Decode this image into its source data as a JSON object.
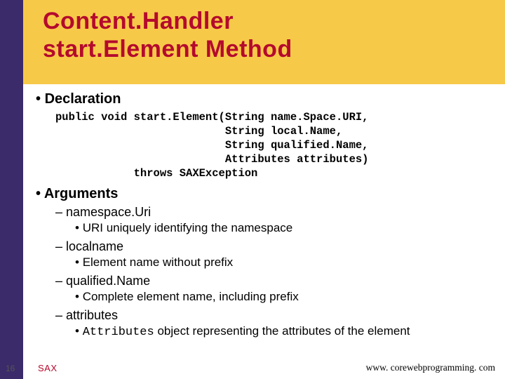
{
  "header": {
    "title_line1": "Content.Handler",
    "title_line2": "start.Element Method"
  },
  "sections": {
    "declaration": {
      "heading": "Declaration",
      "code": "public void start.Element(String name.Space.URI,\n                          String local.Name,\n                          String qualified.Name,\n                          Attributes attributes)\n            throws SAXException"
    },
    "arguments": {
      "heading": "Arguments",
      "items": [
        {
          "name": "namespace.Uri",
          "desc": "URI uniquely identifying the namespace"
        },
        {
          "name": "localname",
          "desc": "Element name without prefix"
        },
        {
          "name": "qualified.Name",
          "desc": "Complete element name, including prefix"
        },
        {
          "name": "attributes",
          "desc_mono": "Attributes",
          "desc_rest": " object representing the attributes of the element"
        }
      ]
    }
  },
  "footer": {
    "page": "16",
    "left": "SAX",
    "right": "www. corewebprogramming. com"
  }
}
